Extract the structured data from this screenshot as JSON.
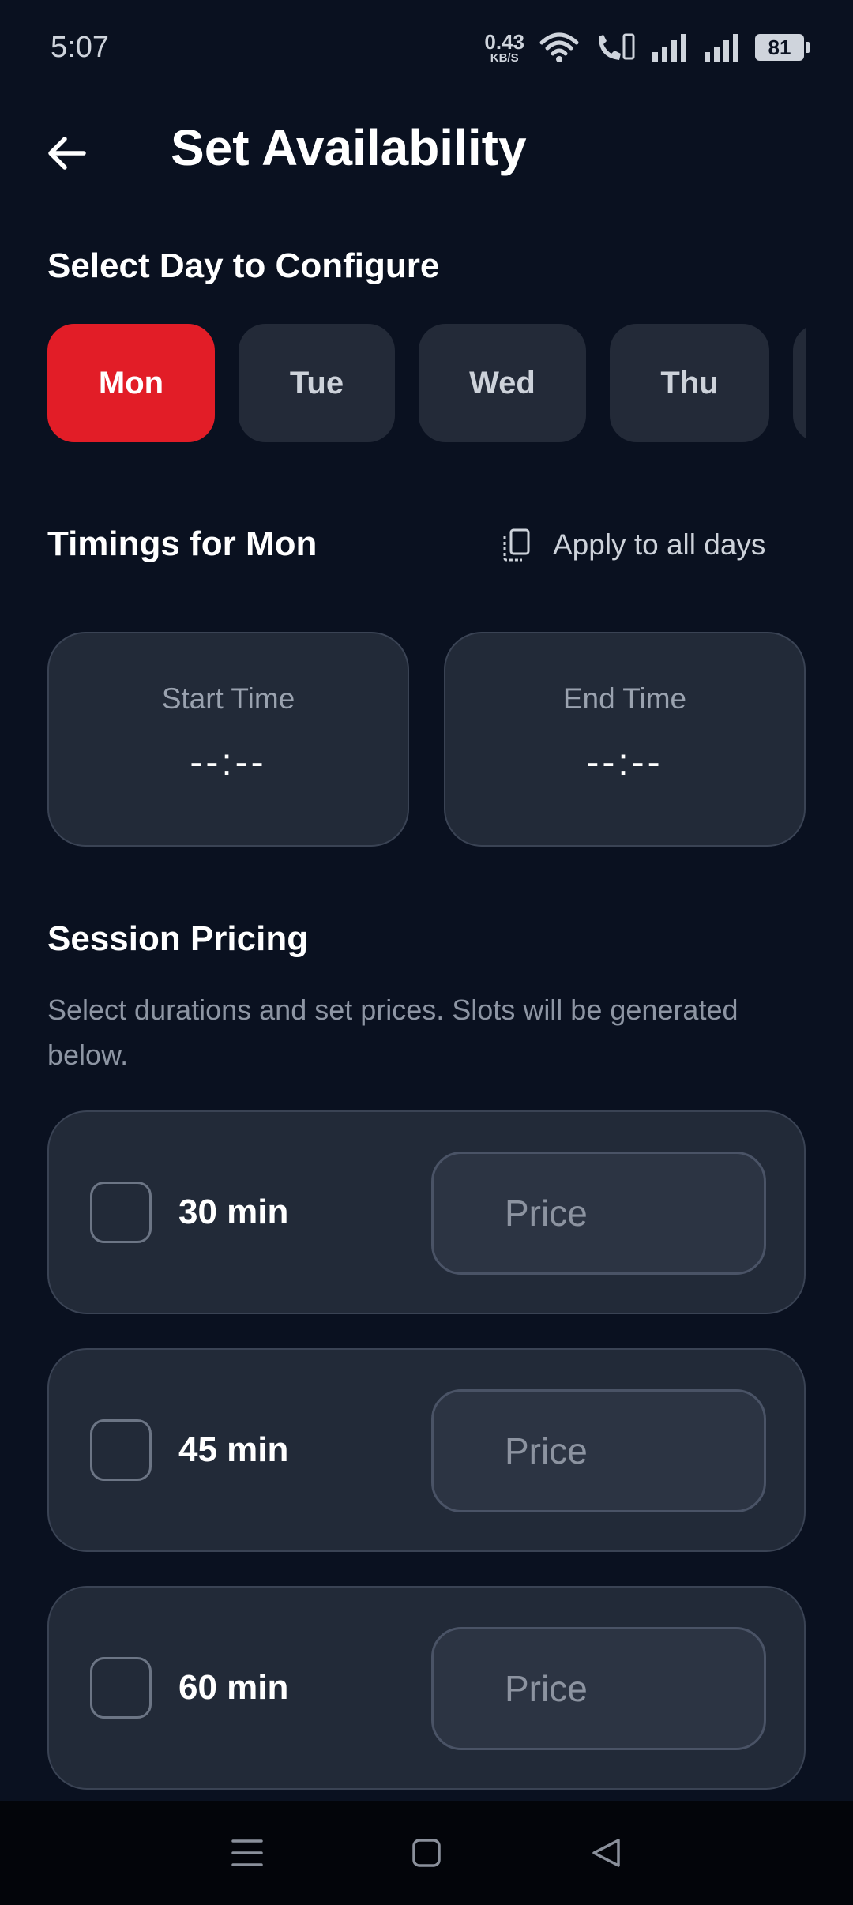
{
  "status_bar": {
    "time": "5:07",
    "net_speed_value": "0.43",
    "net_speed_unit": "KB/S",
    "battery": "81",
    "icons": [
      "wifi-icon",
      "volte-call-icon",
      "signal-icon",
      "signal-icon"
    ]
  },
  "header": {
    "title": "Set Availability",
    "back_icon": "arrow-left-icon"
  },
  "day_section": {
    "label": "Select Day to Configure",
    "days": [
      {
        "label": "Mon",
        "selected": true
      },
      {
        "label": "Tue",
        "selected": false
      },
      {
        "label": "Wed",
        "selected": false
      },
      {
        "label": "Thu",
        "selected": false
      }
    ]
  },
  "timings": {
    "title": "Timings for Mon",
    "apply_all_label": "Apply to all days",
    "apply_all_icon": "copy-icon",
    "start": {
      "label": "Start Time",
      "value": "--:--"
    },
    "end": {
      "label": "End Time",
      "value": "--:--"
    }
  },
  "pricing": {
    "title": "Session Pricing",
    "description": "Select durations and set prices. Slots will be generated below.",
    "options": [
      {
        "duration": "30 min",
        "checked": false,
        "price_placeholder": "Price"
      },
      {
        "duration": "45 min",
        "checked": false,
        "price_placeholder": "Price"
      },
      {
        "duration": "60 min",
        "checked": false,
        "price_placeholder": "Price"
      }
    ]
  },
  "nav_bar": {
    "icons": [
      "menu-icon",
      "home-square-icon",
      "back-triangle-icon"
    ]
  },
  "colors": {
    "background": "#0a1120",
    "card": "#222a38",
    "accent": "#e21d27",
    "muted_text": "#8d95a3"
  }
}
